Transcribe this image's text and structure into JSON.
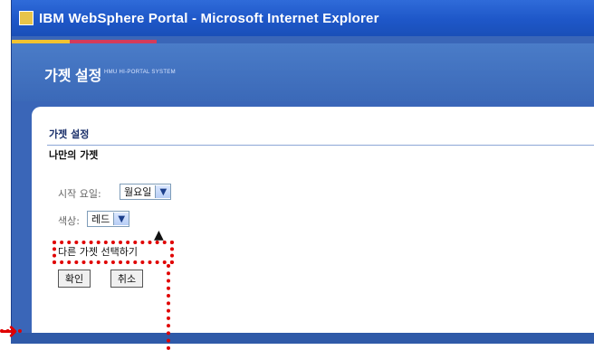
{
  "window": {
    "title": "IBM WebSphere Portal - Microsoft Internet Explorer",
    "portal_title": "가젯 설정",
    "portal_subtitle": "HMU HI-PORTAL SYSTEM"
  },
  "content": {
    "section_title": "가젯 설정",
    "gadget_heading": "나만의 가젯",
    "start_day_label": "시작 요일:",
    "start_day_value": "월요일",
    "color_label": "색상:",
    "color_value": "레드",
    "link_text": "다른 가젯 선택하기",
    "ok_label": "확인",
    "cancel_label": "취소"
  },
  "icons": {
    "title_icon": "ie-window-icon",
    "select_arrow": "chevron-down-icon",
    "cursor": "mouse-cursor-icon",
    "annotation_arrow": "red-arrow-right-icon"
  },
  "colors": {
    "titlebar": "#1e57c8",
    "annotation": "#e00000",
    "section_title": "#1a2f6a"
  }
}
